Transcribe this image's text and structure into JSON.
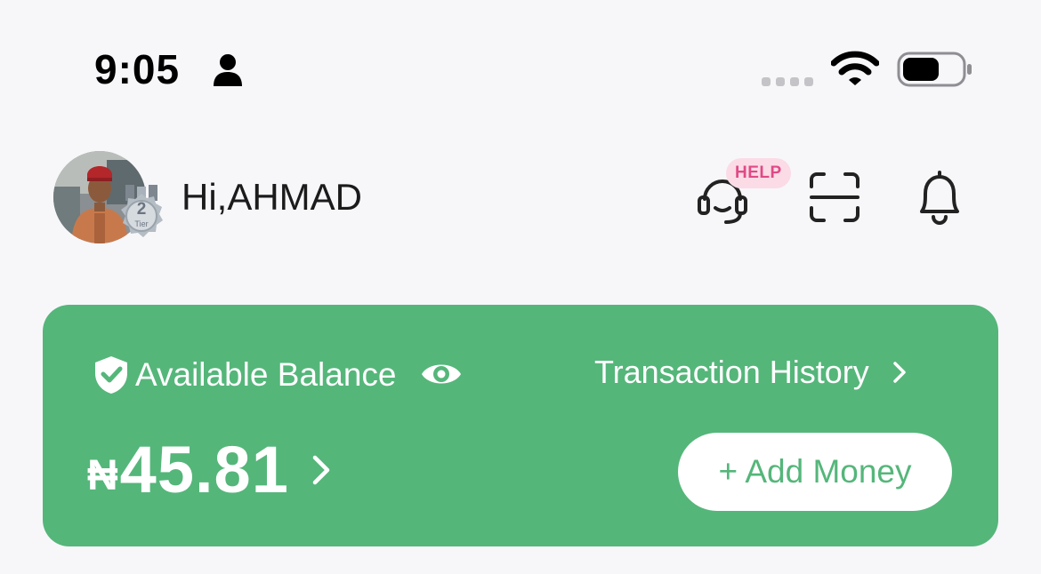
{
  "status_bar": {
    "time": "9:05",
    "icons": [
      "person-icon",
      "signal-dots-icon",
      "wifi-icon",
      "battery-icon"
    ]
  },
  "header": {
    "greeting": "Hi,AHMAD",
    "tier": {
      "number": "2",
      "label": "Tier"
    },
    "help_label": "HELP",
    "icons": [
      "headset-icon",
      "scan-icon",
      "bell-icon"
    ]
  },
  "balance_card": {
    "label": "Available Balance",
    "history_label": "Transaction History",
    "currency_symbol": "₦",
    "amount": "45.81",
    "add_money_label": "+ Add Money",
    "icons": [
      "shield-check-icon",
      "eye-icon",
      "chevron-right-icon"
    ]
  },
  "colors": {
    "background": "#f7f7fa",
    "card_green": "#55b67a",
    "help_pink": "#e04a86",
    "help_pill_bg": "#fbdbe6",
    "white": "#ffffff"
  }
}
